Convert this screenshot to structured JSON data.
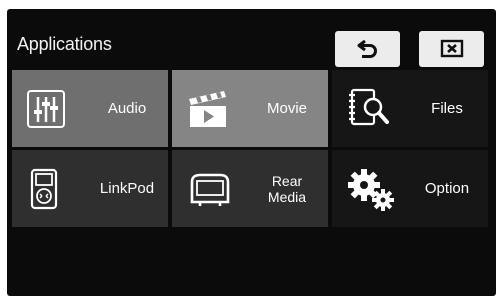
{
  "header": {
    "title": "Applications",
    "back_icon": "back-arrow-icon",
    "close_icon": "close-x-icon"
  },
  "tiles": [
    {
      "label": "Audio",
      "icon": "equalizer-icon"
    },
    {
      "label": "Movie",
      "icon": "clapperboard-icon"
    },
    {
      "label": "Files",
      "icon": "file-search-icon"
    },
    {
      "label": "LinkPod",
      "icon": "media-player-icon"
    },
    {
      "label": "Rear Media",
      "icon": "headrest-screen-icon"
    },
    {
      "label": "Option",
      "icon": "gears-icon"
    }
  ]
}
